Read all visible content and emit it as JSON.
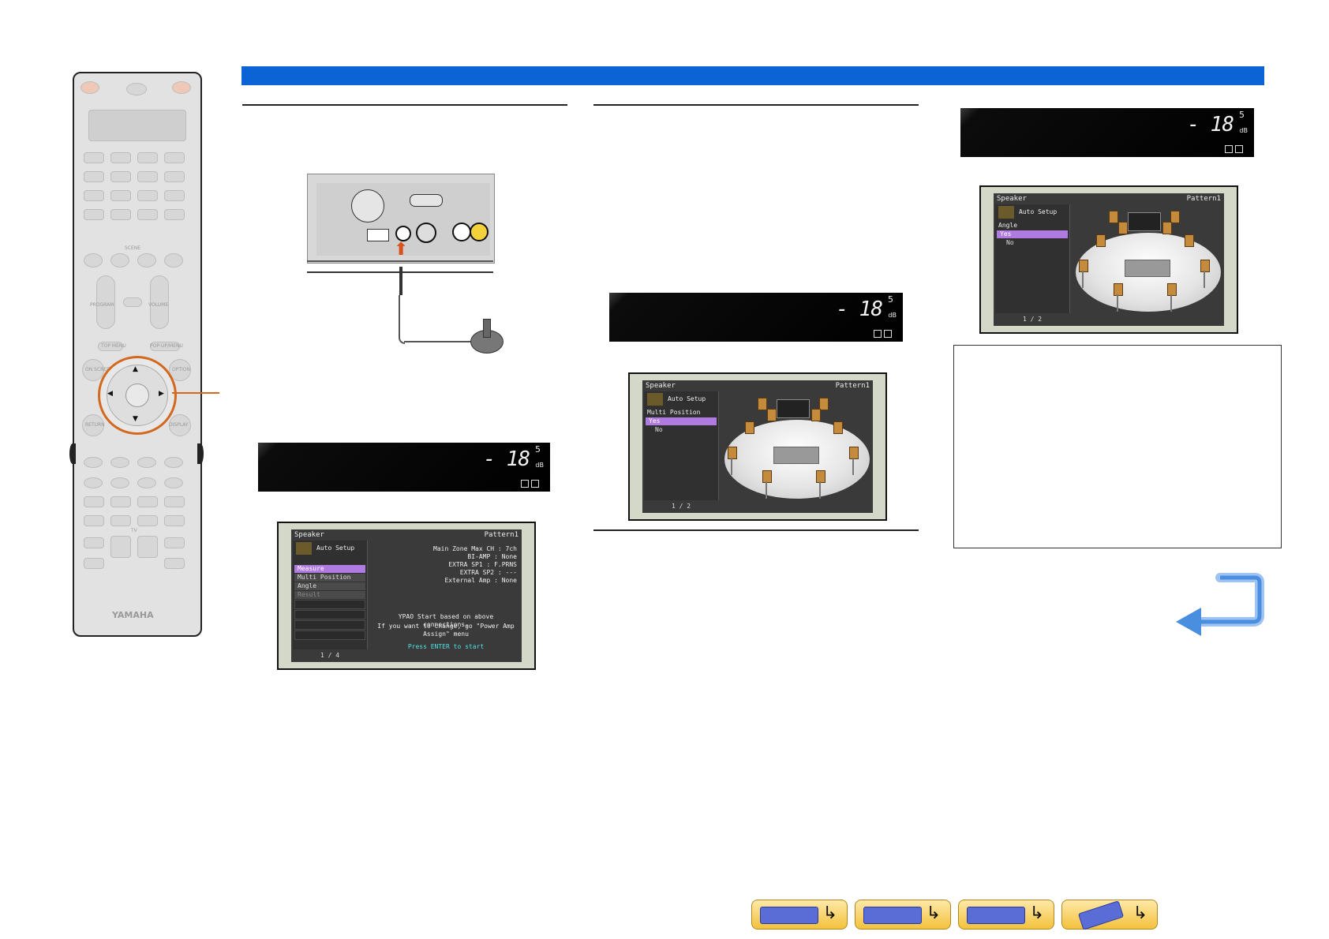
{
  "remote": {
    "brand": "YAMAHA",
    "labels": {
      "scene": "SCENE",
      "program": "PROGRAM",
      "volume": "VOLUME",
      "top_menu": "TOP MENU",
      "popup_menu": "POP-UP/MENU",
      "on_screen": "ON SCREEN",
      "option": "OPTION",
      "return": "RETURN",
      "display": "DISPLAY",
      "tv": "TV"
    }
  },
  "front_display": {
    "value": "-18.5",
    "main": "- 18",
    "sup": "5",
    "unit": "dB"
  },
  "osd_measure": {
    "title_left": "Speaker",
    "title_right": "Pattern1",
    "heading": "Auto Setup",
    "menu": [
      "Measure",
      "Multi Position",
      "Angle",
      "Result"
    ],
    "page": "1 / 4",
    "config_lines": [
      "Main Zone Max CH : 7ch",
      "BI-AMP : None",
      "EXTRA SP1 : F.PRNS",
      "EXTRA SP2 : ---",
      "External Amp : None"
    ],
    "note1": "YPAO Start based on above connections.",
    "note2": "If you want to change, go \"Power Amp Assign\" menu",
    "prompt": "Press ENTER to start"
  },
  "osd_multi": {
    "title_left": "Speaker",
    "title_right": "Pattern1",
    "heading": "Auto Setup",
    "section": "Multi Position",
    "options": [
      "Yes",
      "No"
    ],
    "page": "1 / 2"
  },
  "osd_angle": {
    "title_left": "Speaker",
    "title_right": "Pattern1",
    "heading": "Auto Setup",
    "section": "Angle",
    "options": [
      "Yes",
      "No"
    ],
    "page": "1 / 2"
  },
  "colors": {
    "header_bar": "#0b63d6",
    "accent_orange": "#d2691e",
    "menu_highlight": "#b07be0",
    "prompt_cyan": "#4fe3e3"
  },
  "icons": [
    "return-arrow-icon",
    "receiver-icon",
    "front-panel-icon",
    "rear-panel-icon",
    "remote-icon"
  ]
}
